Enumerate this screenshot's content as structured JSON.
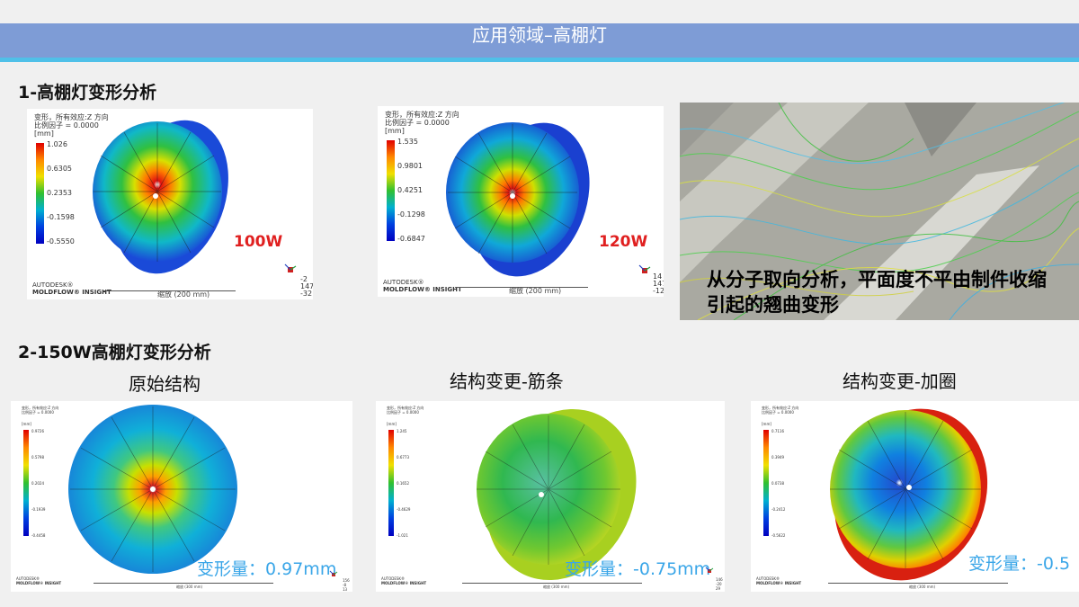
{
  "title": "应用领域–高棚灯",
  "section1": {
    "heading": "1-高棚灯变形分析",
    "panels": [
      {
        "legend_title": "变形，所有效应:Z 方向",
        "scale_factor": "比例因子 = 0.0000",
        "unit": "[mm]",
        "values": [
          "1.026",
          "0.6305",
          "0.2353",
          "-0.1598",
          "-0.5550"
        ],
        "power": "100W",
        "brand_line1": "AUTODESK®",
        "brand_line2": "MOLDFLOW® INSIGHT",
        "scale": "缩放 (200 mm)",
        "triad": [
          "-2",
          "147",
          "-32"
        ]
      },
      {
        "legend_title": "变形，所有效应:Z 方向",
        "scale_factor": "比例因子 = 0.0000",
        "unit": "[mm]",
        "values": [
          "1.535",
          "0.9801",
          "0.4251",
          "-0.1298",
          "-0.6847"
        ],
        "power": "120W",
        "brand_line1": "AUTODESK®",
        "brand_line2": "MOLDFLOW® INSIGHT",
        "scale": "缩放 (200 mm)",
        "triad": [
          "14",
          "147",
          "-12"
        ]
      }
    ],
    "orientation_text": "从分子取向分析，平面度不平由制件收缩引起的翘曲变形"
  },
  "section2": {
    "heading": "2-150W高棚灯变形分析",
    "panels": [
      {
        "caption": "原始结构",
        "deform": "变形量：0.97mm",
        "legend_title": "变形，所有效应:Z 方向",
        "scale_factor": "比例因子 = 0.0000",
        "unit": "[mm]",
        "values": [
          "0.9726",
          "0.5798",
          "0.2024",
          "-0.1939",
          "-0.4458"
        ],
        "scale": "缩放 (300 mm)",
        "brand_line1": "AUTODESK®",
        "brand_line2": "MOLDFLOW® INSIGHT",
        "triad": [
          "156",
          "-8",
          "13"
        ]
      },
      {
        "caption": "结构变更-筋条",
        "deform": "变形量：-0.75mm",
        "legend_title": "变形，所有效应:Z 方向",
        "scale_factor": "比例因子 = 0.0000",
        "unit": "[mm]",
        "values": [
          "1.245",
          "0.6773",
          "0.1652",
          "-0.4629",
          "-1.021"
        ],
        "scale": "缩放 (300 mm)",
        "brand_line1": "AUTODESK®",
        "brand_line2": "MOLDFLOW® INSIGHT",
        "triad": [
          "146",
          "-20",
          "29"
        ]
      },
      {
        "caption": "结构变更-加圈",
        "deform": "变形量：-0.5",
        "legend_title": "变形，所有效应:Z 方向",
        "scale_factor": "比例因子 = 0.0000",
        "unit": "[mm]",
        "values": [
          "0.7116",
          "0.3949",
          "0.0738",
          "-0.2412",
          "-0.5622"
        ],
        "scale": "缩放 (300 mm)",
        "brand_line1": "AUTODESK®",
        "brand_line2": "MOLDFLOW® INSIGHT",
        "triad": []
      }
    ]
  }
}
